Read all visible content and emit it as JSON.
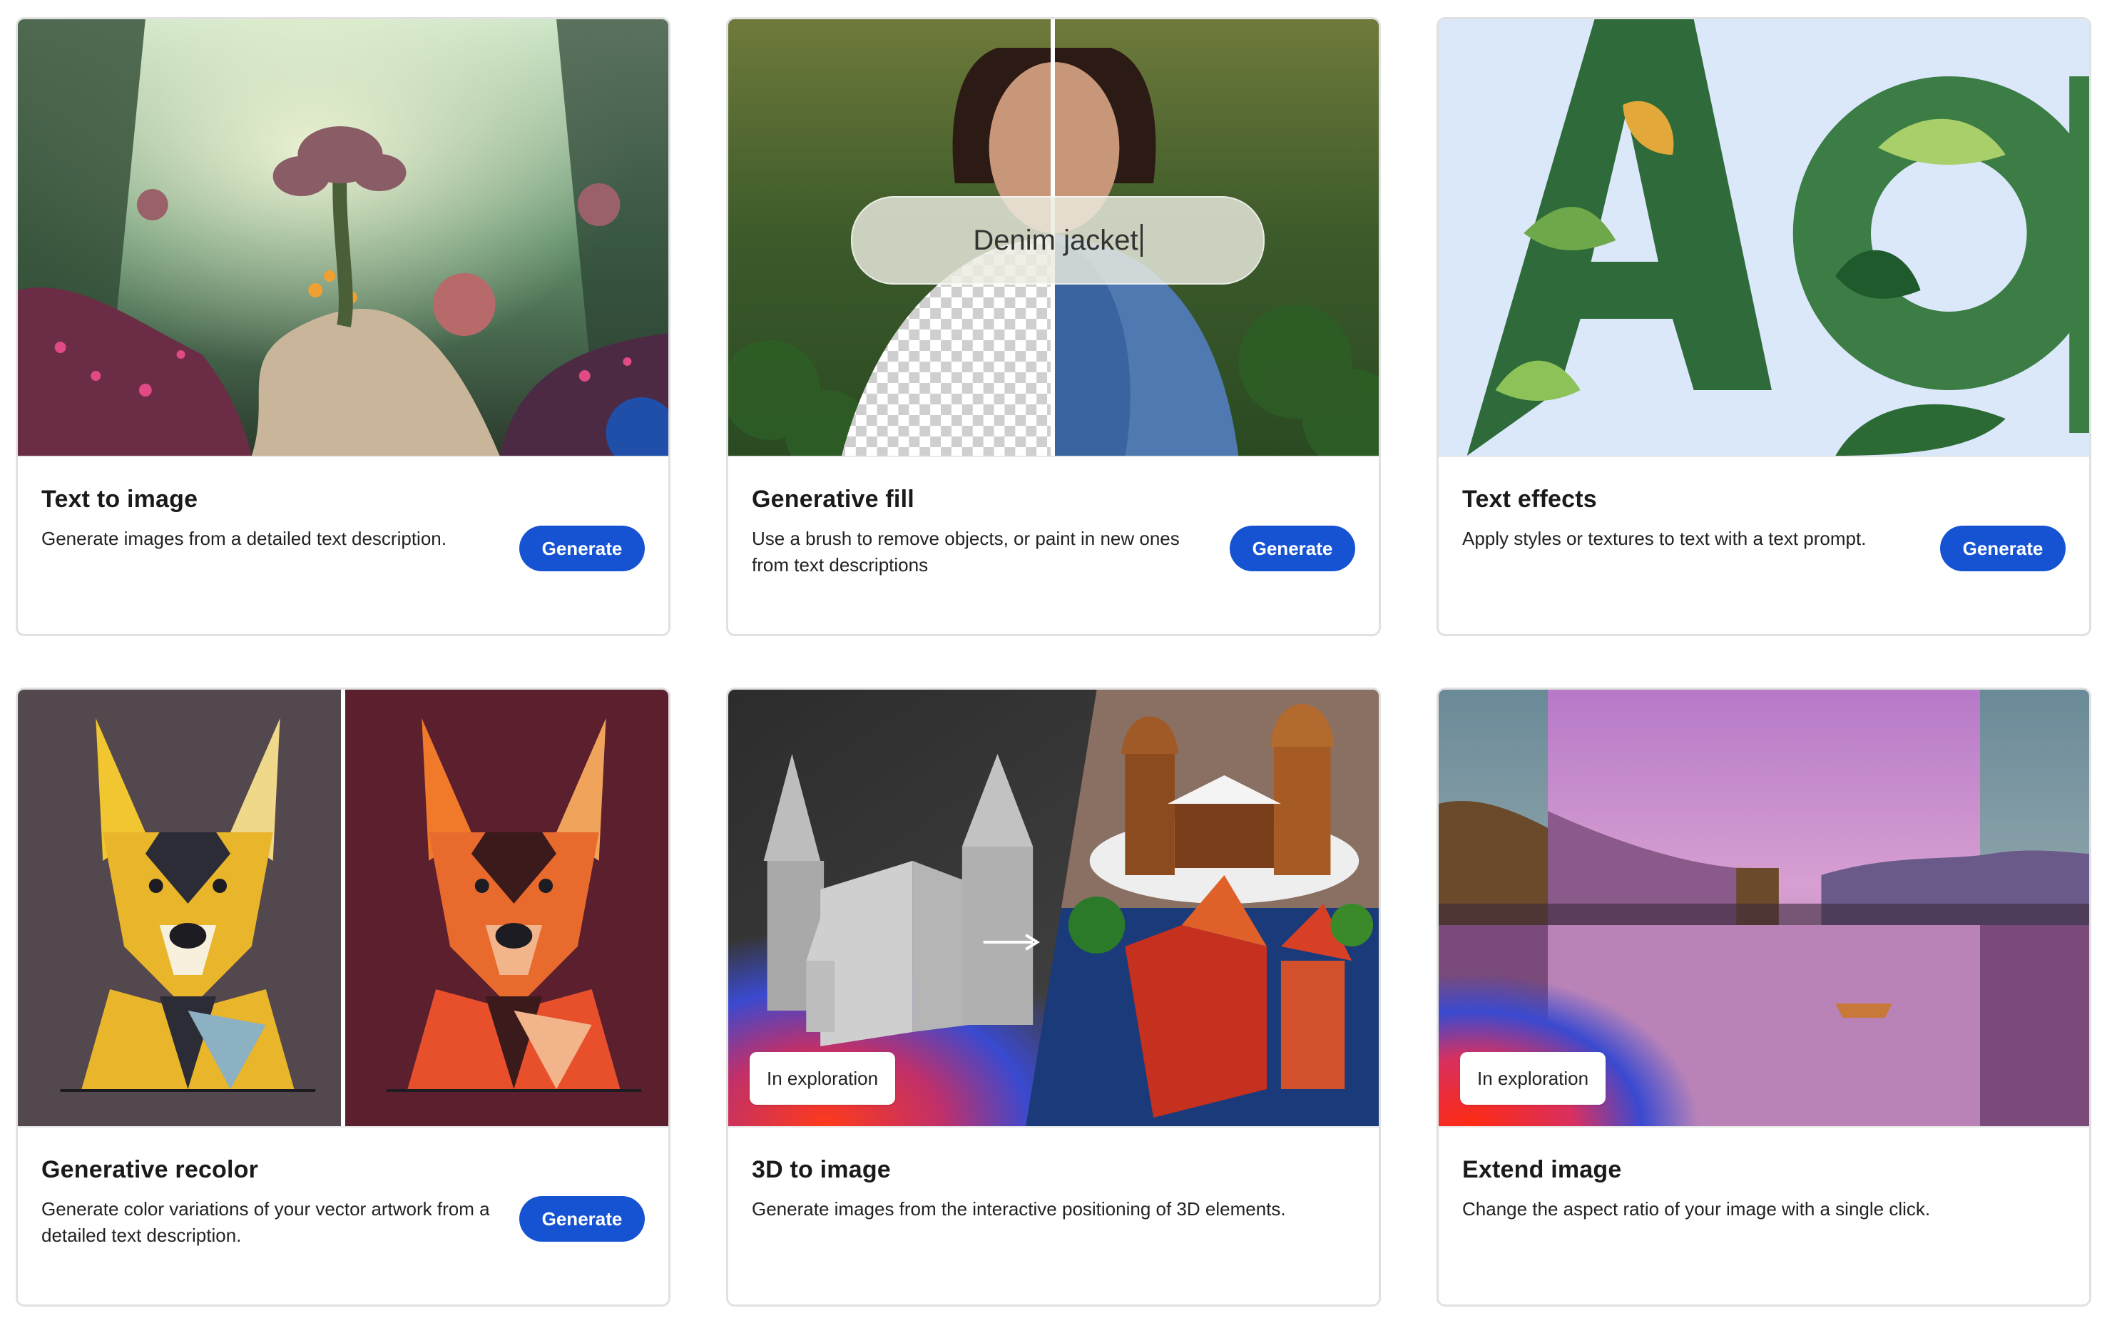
{
  "cards": [
    {
      "title": "Text to image",
      "description": "Generate images from a detailed text description.",
      "button": "Generate"
    },
    {
      "title": "Generative fill",
      "description": "Use a brush to remove objects, or paint in new ones from text descriptions",
      "button": "Generate",
      "prompt_text": "Denim jacket"
    },
    {
      "title": "Text effects",
      "description": "Apply styles or textures to text with a text prompt.",
      "button": "Generate"
    },
    {
      "title": "Generative recolor",
      "description": "Generate color variations of your vector artwork from a detailed text description.",
      "button": "Generate"
    },
    {
      "title": "3D to image",
      "description": "Generate images from the interactive positioning of 3D elements.",
      "badge": "In exploration"
    },
    {
      "title": "Extend image",
      "description": "Change the aspect ratio of your image with a single click.",
      "badge": "In exploration"
    }
  ],
  "colors": {
    "button": "#1553d2",
    "card_border": "#e1e1e1"
  }
}
